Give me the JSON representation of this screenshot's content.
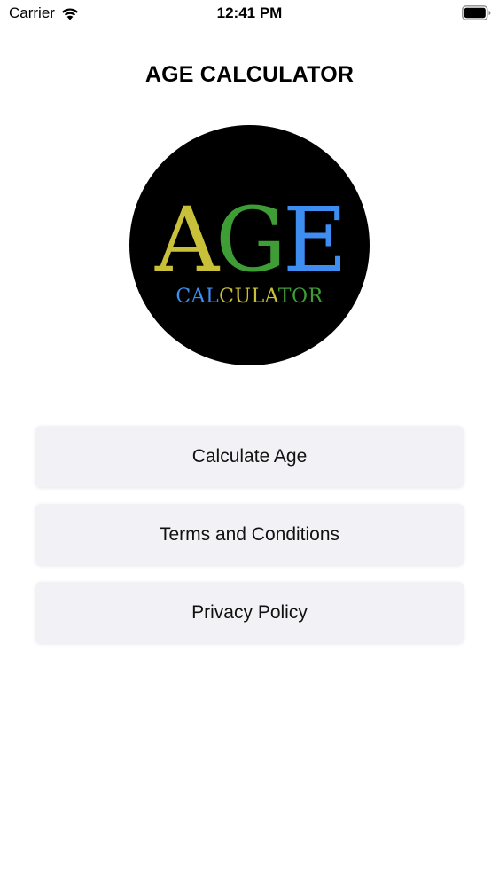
{
  "status_bar": {
    "carrier": "Carrier",
    "time": "12:41 PM",
    "icons": [
      "wifi-icon",
      "battery-icon"
    ]
  },
  "header": {
    "title": "AGE CALCULATOR"
  },
  "logo": {
    "main_letters": [
      {
        "char": "A",
        "color": "#c9c03a"
      },
      {
        "char": "G",
        "color": "#3e9e35"
      },
      {
        "char": "E",
        "color": "#3d8ef0"
      }
    ],
    "sub_letters": [
      {
        "char": "C",
        "color": "#3d8ef0"
      },
      {
        "char": "A",
        "color": "#3d8ef0"
      },
      {
        "char": "L",
        "color": "#3d8ef0"
      },
      {
        "char": "C",
        "color": "#c9c03a"
      },
      {
        "char": "U",
        "color": "#c9c03a"
      },
      {
        "char": "L",
        "color": "#c9c03a"
      },
      {
        "char": "A",
        "color": "#c9c03a"
      },
      {
        "char": "T",
        "color": "#3e9e35"
      },
      {
        "char": "O",
        "color": "#3e9e35"
      },
      {
        "char": "R",
        "color": "#3e9e35"
      }
    ],
    "background": "#000000"
  },
  "menu": {
    "calculate_label": "Calculate Age",
    "terms_label": "Terms and Conditions",
    "privacy_label": "Privacy Policy"
  },
  "colors": {
    "button_bg": "#f2f1f5",
    "text": "#000000"
  }
}
